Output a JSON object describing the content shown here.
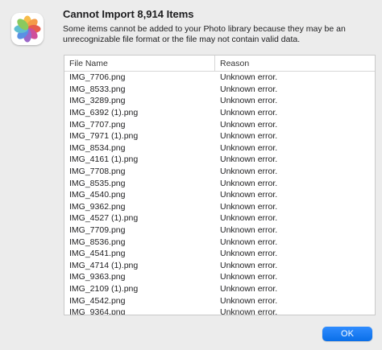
{
  "dialog": {
    "title": "Cannot Import 8,914 Items",
    "message": "Some items cannot be added to your Photo library because they may be an unrecognizable file format or the file may not contain valid data.",
    "ok_label": "OK"
  },
  "table": {
    "columns": [
      "File Name",
      "Reason"
    ],
    "rows": [
      {
        "file": "IMG_7706.png",
        "reason": "Unknown error."
      },
      {
        "file": "IMG_8533.png",
        "reason": "Unknown error."
      },
      {
        "file": "IMG_3289.png",
        "reason": "Unknown error."
      },
      {
        "file": "IMG_6392 (1).png",
        "reason": "Unknown error."
      },
      {
        "file": "IMG_7707.png",
        "reason": "Unknown error."
      },
      {
        "file": "IMG_7971 (1).png",
        "reason": "Unknown error."
      },
      {
        "file": "IMG_8534.png",
        "reason": "Unknown error."
      },
      {
        "file": "IMG_4161 (1).png",
        "reason": "Unknown error."
      },
      {
        "file": "IMG_7708.png",
        "reason": "Unknown error."
      },
      {
        "file": "IMG_8535.png",
        "reason": "Unknown error."
      },
      {
        "file": "IMG_4540.png",
        "reason": "Unknown error."
      },
      {
        "file": "IMG_9362.png",
        "reason": "Unknown error."
      },
      {
        "file": "IMG_4527 (1).png",
        "reason": "Unknown error."
      },
      {
        "file": "IMG_7709.png",
        "reason": "Unknown error."
      },
      {
        "file": "IMG_8536.png",
        "reason": "Unknown error."
      },
      {
        "file": "IMG_4541.png",
        "reason": "Unknown error."
      },
      {
        "file": "IMG_4714 (1).png",
        "reason": "Unknown error."
      },
      {
        "file": "IMG_9363.png",
        "reason": "Unknown error."
      },
      {
        "file": "IMG_2109 (1).png",
        "reason": "Unknown error."
      },
      {
        "file": "IMG_4542.png",
        "reason": "Unknown error."
      },
      {
        "file": "IMG_9364.png",
        "reason": "Unknown error."
      }
    ]
  },
  "icons": {
    "app": "photos-icon"
  }
}
